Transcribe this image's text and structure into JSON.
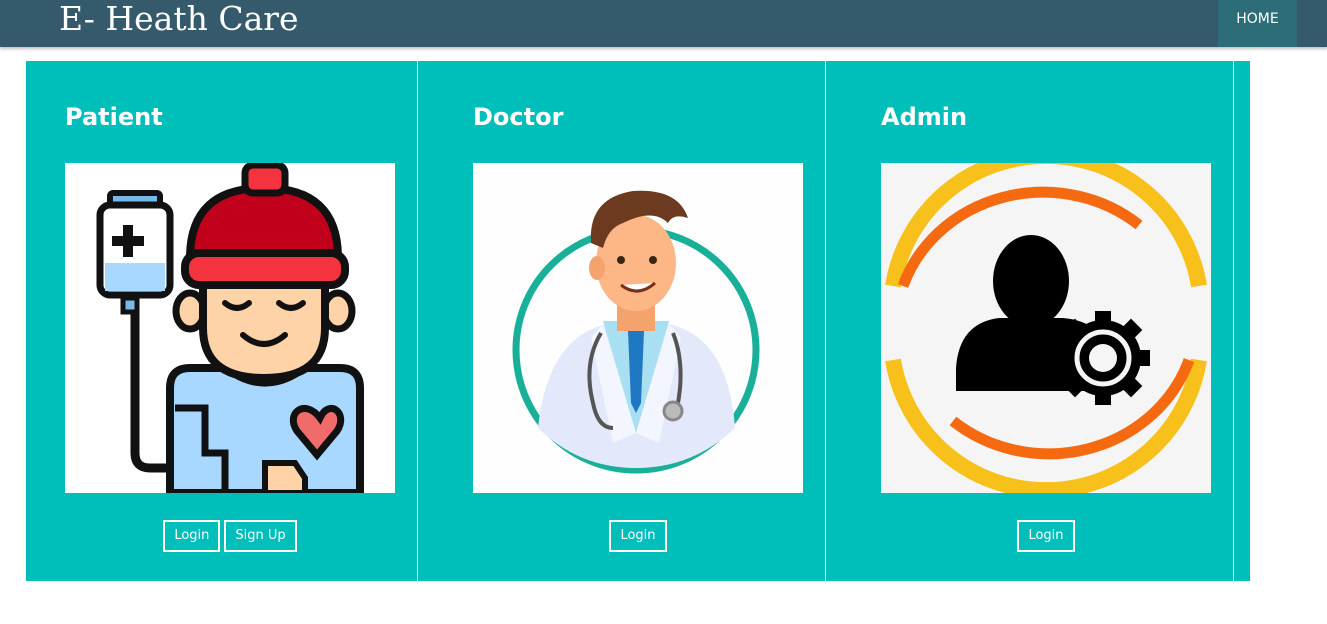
{
  "header": {
    "brand": "E- Heath Care",
    "nav_home": "HOME"
  },
  "cards": [
    {
      "title": "Patient",
      "image_icon": "patient-illustration",
      "buttons": [
        "Login",
        "Sign Up"
      ]
    },
    {
      "title": "Doctor",
      "image_icon": "doctor-illustration",
      "buttons": [
        "Login"
      ]
    },
    {
      "title": "Admin",
      "image_icon": "admin-illustration",
      "buttons": [
        "Login"
      ]
    }
  ],
  "colors": {
    "navbar": "#355a6c",
    "nav_active": "#2c6d77",
    "panel": "#00bfbb",
    "text": "#ffffff"
  }
}
